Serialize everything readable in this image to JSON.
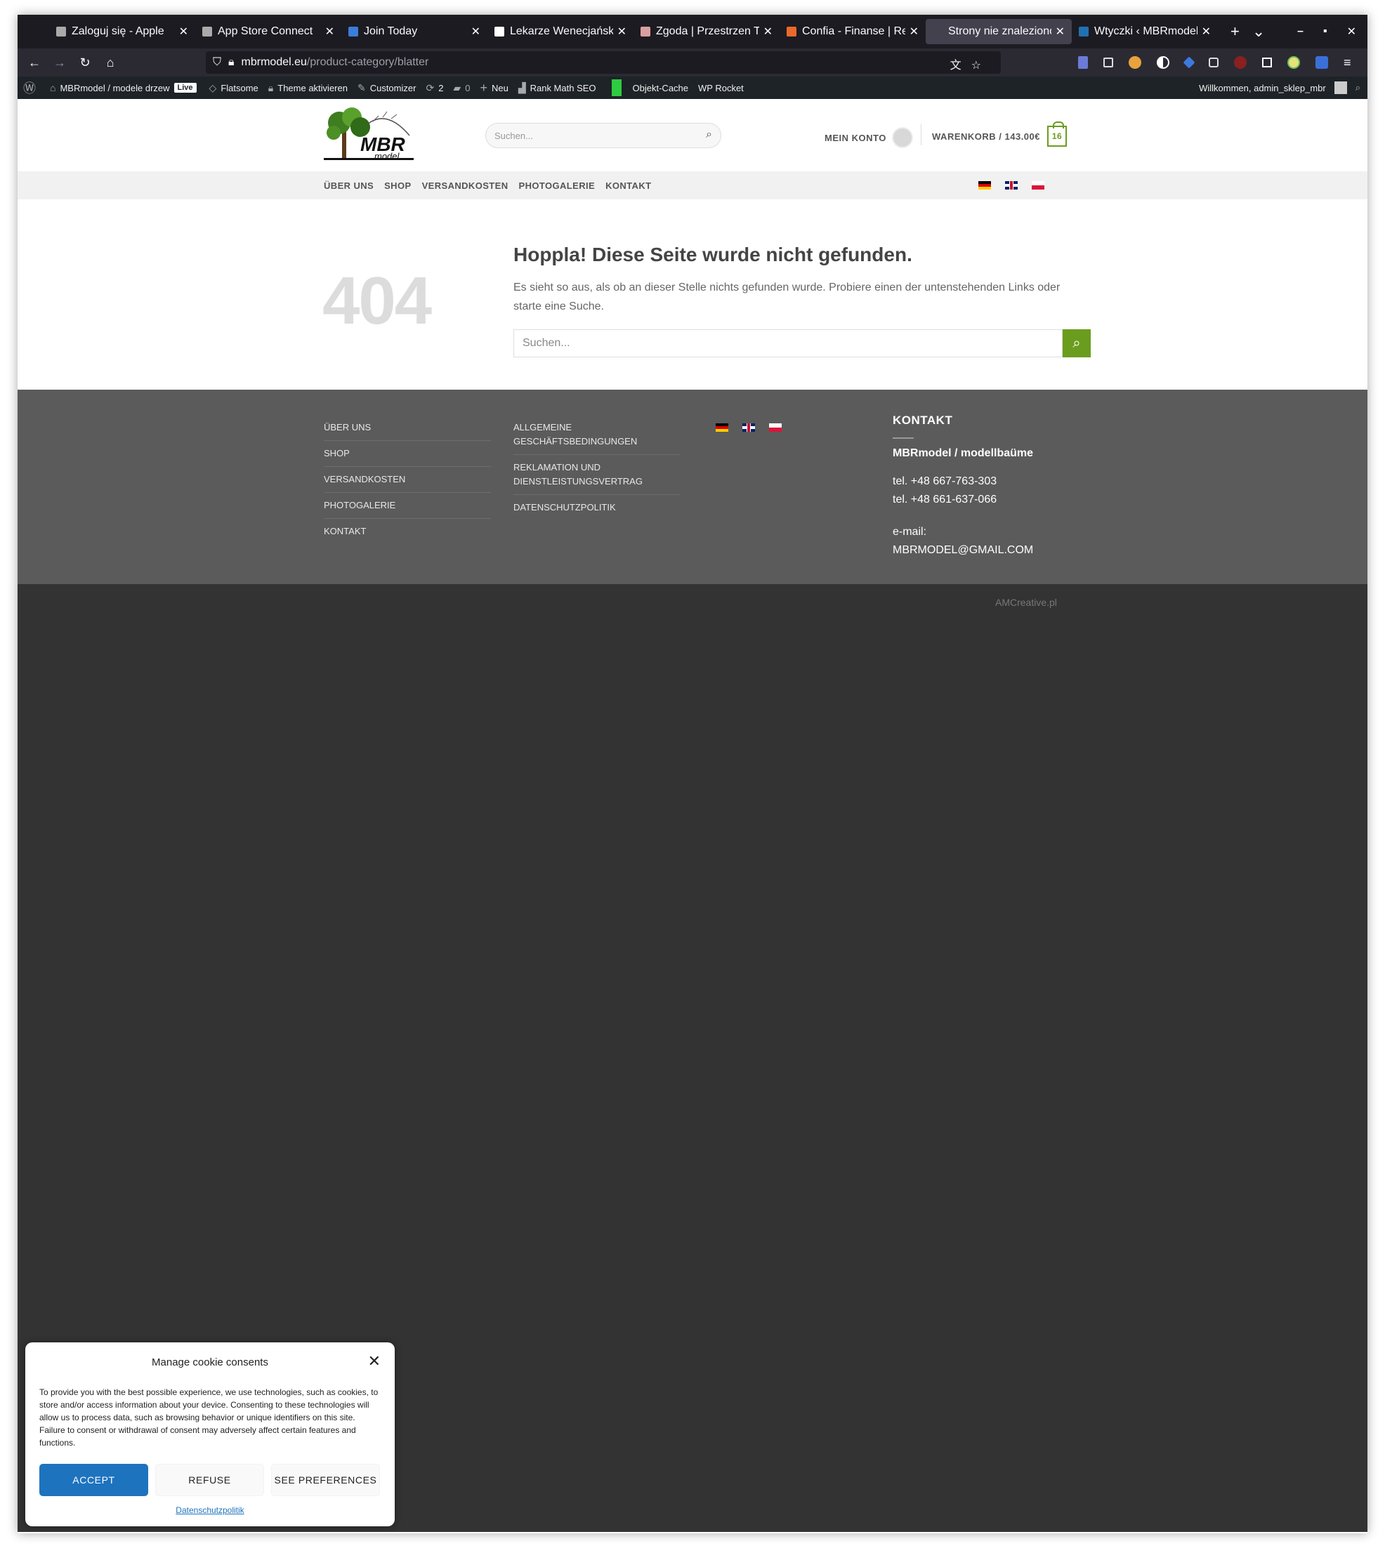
{
  "browser": {
    "tabs": [
      {
        "title": "Zaloguj się - Apple",
        "color": "#aaaaaa"
      },
      {
        "title": "App Store Connect",
        "color": "#aaaaaa"
      },
      {
        "title": "Join Today",
        "color": "#3b7dd8"
      },
      {
        "title": "Lekarze Wenecjańska P",
        "color": "#ffffff"
      },
      {
        "title": "Zgoda | Przestrzen Tera",
        "color": "#d9a0a0"
      },
      {
        "title": "Confia - Finanse | Restr",
        "color": "#e86a2b"
      },
      {
        "title": "Strony nie znaleziono - MB",
        "color": "#42414d",
        "active": true
      },
      {
        "title": "Wtyczki ‹ MBRmodel / mod",
        "color": "#2271b1"
      }
    ],
    "url_host": "mbrmodel.eu",
    "url_path": "/product-category/blatter"
  },
  "adminbar": {
    "site_name": "MBRmodel / modele drzew",
    "live_badge": "Live",
    "flatsome": "Flatsome",
    "theme_activate": "Theme aktivieren",
    "customizer": "Customizer",
    "updates_count": "2",
    "comments_count": "0",
    "new_label": "Neu",
    "rank_math": "Rank Math SEO",
    "object_cache": "Objekt-Cache",
    "wp_rocket": "WP Rocket",
    "welcome": "Willkommen, admin_sklep_mbr"
  },
  "header": {
    "logo_text": "MBR",
    "logo_sub": "model",
    "search_placeholder": "Suchen...",
    "account_label": "MEIN KONTO",
    "cart_label": "WARENKORB / 143.00€",
    "cart_count": "16"
  },
  "nav": {
    "items": [
      "ÜBER UNS",
      "SHOP",
      "VERSANDKOSTEN",
      "PHOTOGALERIE",
      "KONTAKT"
    ]
  },
  "error": {
    "code": "404",
    "title": "Hoppla! Diese Seite wurde nicht gefunden.",
    "text": "Es sieht so aus, als ob an dieser Stelle nichts gefunden wurde. Probiere einen der untenstehenden Links oder starte eine Suche.",
    "search_placeholder": "Suchen..."
  },
  "footer": {
    "col1": [
      "ÜBER UNS",
      "SHOP",
      "VERSANDKOSTEN",
      "PHOTOGALERIE",
      "KONTAKT"
    ],
    "col2": [
      "ALLGEMEINE GESCHÄFTSBEDINGUNGEN",
      "REKLAMATION UND DIENSTLEISTUNGSVERTRAG",
      "DATENSCHUTZPOLITIK"
    ],
    "contact_heading": "KONTAKT",
    "company": "MBRmodel / modellbaüme",
    "phone1": "tel. +48 667-763-303",
    "phone2": "tel. +48 661-637-066",
    "email_label": "e-mail:",
    "email": "MBRMODEL@GMAIL.COM",
    "credit": "AMCreative.pl"
  },
  "cookie": {
    "title": "Manage cookie consents",
    "message": "To provide you with the best possible experience, we use technologies, such as cookies, to store and/or access information about your device. Consenting to these technologies will allow us to process data, such as browsing behavior or unique identifiers on this site. Failure to consent or withdrawal of consent may adversely affect certain features and functions.",
    "accept": "ACCEPT",
    "refuse": "REFUSE",
    "preferences": "SEE PREFERENCES",
    "policy_link": "Datenschutzpolitik"
  },
  "colors": {
    "accent_green": "#6a9d1e",
    "button_blue": "#1e73be",
    "footer_bg": "#5b5b5b",
    "bottom_bg": "#333333"
  }
}
